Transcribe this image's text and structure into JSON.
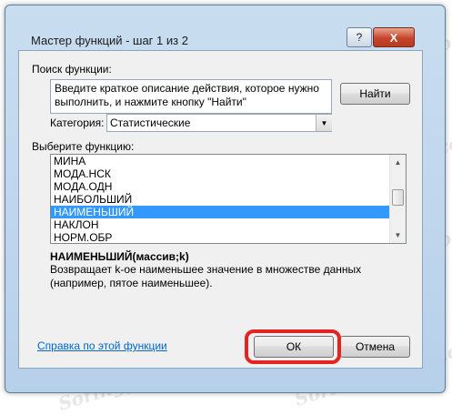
{
  "dialog": {
    "title": "Мастер функций - шаг 1 из 2",
    "help_glyph": "?",
    "close_glyph": "X"
  },
  "search": {
    "label": "Поиск функции:",
    "value": "Введите краткое описание действия, которое нужно выполнить, и нажмите кнопку \"Найти\"",
    "find_button": "Найти"
  },
  "category": {
    "label": "Категория:",
    "selected": "Статистические"
  },
  "function_list": {
    "label": "Выберите функцию:",
    "items": [
      "МИНА",
      "МОДА.НСК",
      "МОДА.ОДН",
      "НАИБОЛЬШИЙ",
      "НАИМЕНЬШИЙ",
      "НАКЛОН",
      "НОРМ.ОБР"
    ],
    "selected_index": 4
  },
  "function_info": {
    "signature": "НАИМЕНЬШИЙ(массив;k)",
    "description": "Возвращает k-ое наименьшее значение в множестве данных (например, пятое наименьшее)."
  },
  "footer": {
    "help_link": "Справка по этой функции",
    "ok_button": "ОК",
    "cancel_button": "Отмена"
  },
  "watermark": "Soringpcrepair.com",
  "colors": {
    "selection": "#3399ff",
    "highlight": "#e52421",
    "link": "#0066cc"
  }
}
